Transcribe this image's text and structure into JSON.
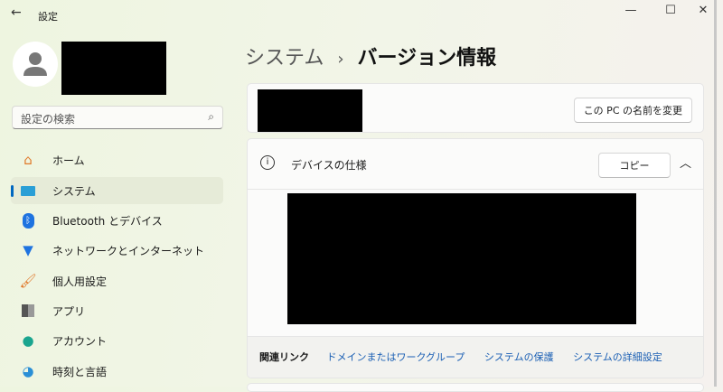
{
  "window": {
    "title": "設定",
    "minimize": "—",
    "maximize": "☐",
    "close": "✕"
  },
  "search": {
    "placeholder": "設定の検索"
  },
  "sidebar": {
    "items": [
      {
        "label": "ホーム",
        "icon": "home-icon"
      },
      {
        "label": "システム",
        "icon": "system-icon",
        "selected": true
      },
      {
        "label": "Bluetooth とデバイス",
        "icon": "bluetooth-icon"
      },
      {
        "label": "ネットワークとインターネット",
        "icon": "wifi-icon"
      },
      {
        "label": "個人用設定",
        "icon": "brush-icon"
      },
      {
        "label": "アプリ",
        "icon": "apps-icon"
      },
      {
        "label": "アカウント",
        "icon": "account-icon"
      },
      {
        "label": "時刻と言語",
        "icon": "globe-clock-icon"
      }
    ]
  },
  "breadcrumb": {
    "parent": "システム",
    "separator": "›",
    "current": "バージョン情報"
  },
  "pc": {
    "rename_button": "この PC の名前を変更"
  },
  "specs": {
    "title": "デバイスの仕様",
    "copy_button": "コピー"
  },
  "related": {
    "label": "関連リンク",
    "links": [
      "ドメインまたはワークグループ",
      "システムの保護",
      "システムの詳細設定"
    ]
  },
  "colors": {
    "accent": "#0067c0",
    "link": "#1a5fb4"
  }
}
